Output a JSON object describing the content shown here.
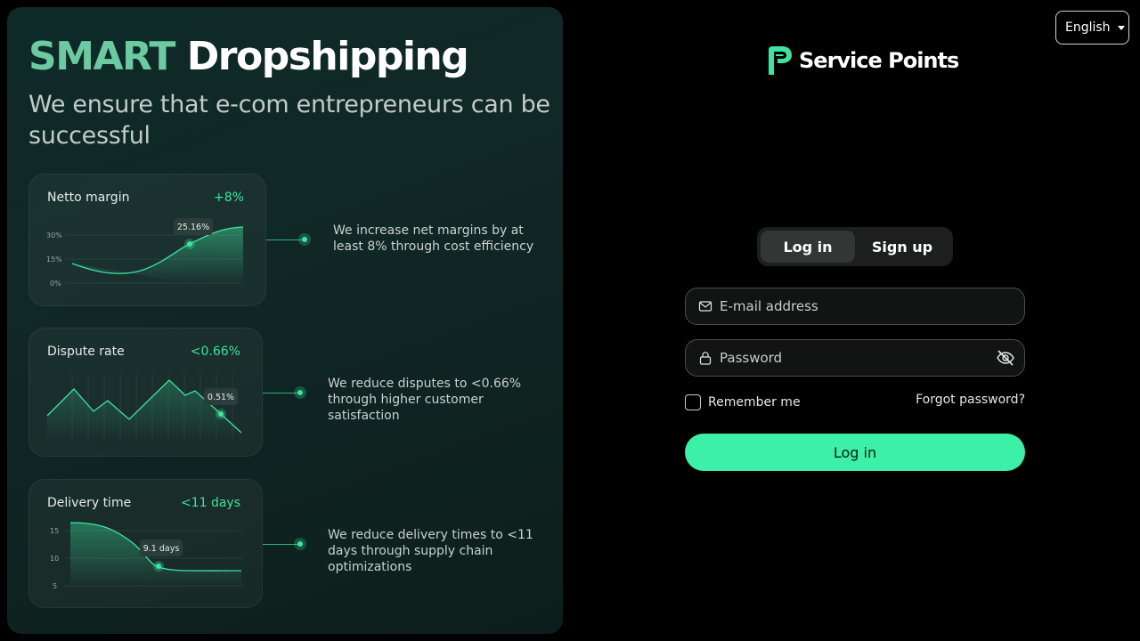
{
  "language": {
    "label": "English"
  },
  "brand": {
    "name": "Service Points"
  },
  "hero": {
    "title_accent": "SMART",
    "title_rest": "Dropshipping",
    "subtitle": "We ensure that e-com entrepreneurs can be successful"
  },
  "cards": [
    {
      "title": "Netto margin",
      "value": "+8%",
      "description": "We increase net margins by at least 8% through cost efficiency",
      "tooltip": "25.16%",
      "y_ticks": [
        "30%",
        "15%",
        "0%"
      ]
    },
    {
      "title": "Dispute rate",
      "value": "<0.66%",
      "description": "We reduce disputes to <0.66% through higher customer satisfaction",
      "tooltip": "0.51%"
    },
    {
      "title": "Delivery time",
      "value": "<11 days",
      "description": "We reduce delivery times to <11 days through supply chain optimizations",
      "tooltip": "9.1 days",
      "y_ticks": [
        "15",
        "10",
        "5"
      ]
    }
  ],
  "auth": {
    "tabs": [
      {
        "label": "Log in",
        "active": true
      },
      {
        "label": "Sign up",
        "active": false
      }
    ],
    "email_placeholder": "E-mail address",
    "password_placeholder": "Password",
    "remember_label": "Remember me",
    "forgot_label": "Forgot password?",
    "submit_label": "Log in"
  },
  "colors": {
    "accent": "#3de39f",
    "button": "#3cf0a8",
    "hero_accent": "#6cc9a1"
  }
}
